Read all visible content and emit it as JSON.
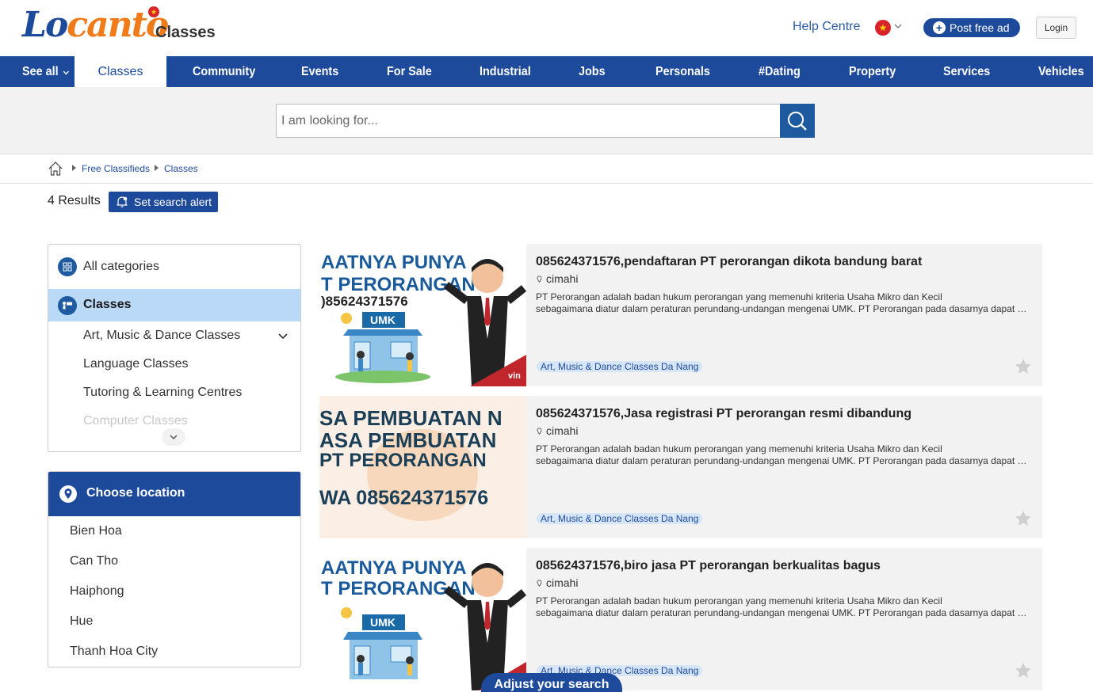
{
  "header": {
    "logo_lo": "Lo",
    "logo_c": "c",
    "logo_anto": "anto",
    "section": "Classes",
    "help": "Help Centre",
    "post_ad": "Post free ad",
    "login": "Login",
    "flag_icon": "vietnam-flag-icon"
  },
  "nav": {
    "see_all": "See all",
    "items": [
      "Classes",
      "Community",
      "Events",
      "For Sale",
      "Industrial",
      "Jobs",
      "Personals",
      "#Dating",
      "Property",
      "Services",
      "Vehicles"
    ],
    "active_index": 0
  },
  "search": {
    "placeholder": "I am looking for..."
  },
  "breadcrumb": [
    "Free Classifieds",
    "Classes"
  ],
  "results": {
    "count_label": "4 Results",
    "alert_label": "Set search alert"
  },
  "categories": {
    "all": "All categories",
    "current": "Classes",
    "sub": [
      "Art, Music & Dance Classes",
      "Language Classes",
      "Tutoring & Learning Centres",
      "Computer Classes"
    ]
  },
  "location": {
    "title": "Choose location",
    "items": [
      "Bien Hoa",
      "Can Tho",
      "Haiphong",
      "Hue",
      "Thanh Hoa City"
    ]
  },
  "listings": [
    {
      "title": "085624371576,pendaftaran PT perorangan dikota bandung barat",
      "location": "cimahi",
      "desc1": "PT Perorangan adalah badan hukum perorangan yang memenuhi kriteria Usaha Mikro dan Kecil",
      "desc2": "sebagaimana diatur dalam peraturan perundang-undangan mengenai UMK. PT Perorangan pada dasarnya dapat didirikan oleh satu orang",
      "tag": "Art, Music & Dance Classes Da Nang",
      "img_line1": "AATNYA PUNYA",
      "img_line2": "T PERORANGAN",
      "img_line3": ")85624371576",
      "img_sign": "UMK",
      "img_brand": "vin"
    },
    {
      "title": "085624371576,Jasa registrasi PT perorangan resmi dibandung",
      "location": "cimahi",
      "desc1": "PT Perorangan adalah badan hukum perorangan yang memenuhi kriteria Usaha Mikro dan Kecil",
      "desc2": "sebagaimana diatur dalam peraturan perundang-undangan mengenai UMK. PT Perorangan pada dasarnya dapat didirikan oleh satu orang",
      "tag": "Art, Music & Dance Classes Da Nang",
      "img_line1": "SA PEMBUATAN N",
      "img_line2": "ASA PEMBUATAN",
      "img_line3": "PT PERORANGAN",
      "img_line4": "WA 085624371576"
    },
    {
      "title": "085624371576,biro jasa PT perorangan berkualitas bagus",
      "location": "cimahi",
      "desc1": "PT Perorangan adalah badan hukum perorangan yang memenuhi kriteria Usaha Mikro dan Kecil",
      "desc2": "sebagaimana diatur dalam peraturan perundang-undangan mengenai UMK. PT Perorangan pada dasarnya dapat didirikan oleh satu orang",
      "tag": "Art, Music & Dance Classes Da Nang",
      "img_line1": "AATNYA PUNYA",
      "img_line2": "T PERORANGAN",
      "img_sign": "UMK"
    }
  ],
  "adjust": "Adjust your search"
}
